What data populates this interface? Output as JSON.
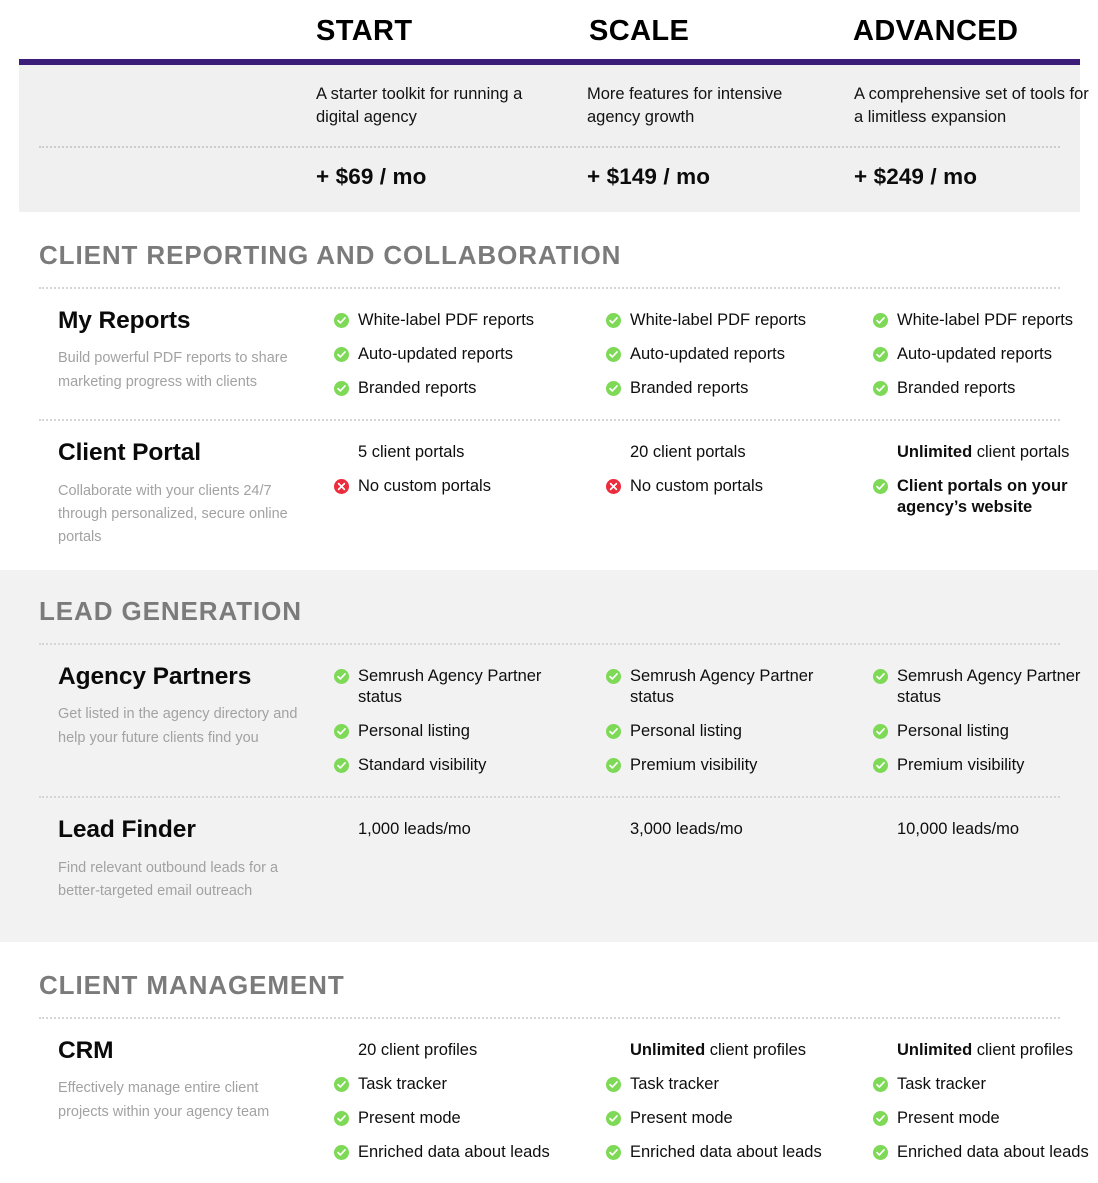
{
  "plans": [
    {
      "name": "START",
      "description": "A starter toolkit for running a digital agency",
      "price": "+ $69 / mo"
    },
    {
      "name": "SCALE",
      "description": "More features for intensive agency growth",
      "price": "+ $149 / mo"
    },
    {
      "name": "ADVANCED",
      "description": "A comprehensive set of tools for a limitless expansion",
      "price": "+ $249 / mo"
    }
  ],
  "colors": {
    "accent_purple": "#3b1d79",
    "check_green": "#7ed957",
    "cross_red": "#ec2b3c",
    "panel_gray": "#f0f0f0",
    "band_gray": "#f2f2f2",
    "section_title_gray": "#7b7b7b",
    "subtext_gray": "#a2a2a2"
  },
  "icons": {
    "check": "check-circle-icon",
    "cross": "cross-circle-icon"
  },
  "sections": [
    {
      "title": "CLIENT REPORTING AND COLLABORATION",
      "shaded": false,
      "features": [
        {
          "name": "My Reports",
          "subtitle": "Build powerful PDF reports to share marketing progress with clients",
          "cells": [
            {
              "items": [
                {
                  "icon": "check",
                  "text": "White-label PDF reports"
                },
                {
                  "icon": "check",
                  "text": "Auto-updated reports"
                },
                {
                  "icon": "check",
                  "text": "Branded reports"
                }
              ]
            },
            {
              "items": [
                {
                  "icon": "check",
                  "text": "White-label PDF reports"
                },
                {
                  "icon": "check",
                  "text": "Auto-updated reports"
                },
                {
                  "icon": "check",
                  "text": "Branded reports"
                }
              ]
            },
            {
              "items": [
                {
                  "icon": "check",
                  "text": "White-label PDF reports"
                },
                {
                  "icon": "check",
                  "text": "Auto-updated reports"
                },
                {
                  "icon": "check",
                  "text": "Branded reports"
                }
              ]
            }
          ]
        },
        {
          "name": "Client Portal",
          "subtitle": "Collaborate with your clients 24/7 through personalized, secure online portals",
          "cells": [
            {
              "items": [
                {
                  "icon": "none",
                  "text": "5 client portals"
                },
                {
                  "icon": "cross",
                  "text": "No custom portals"
                }
              ]
            },
            {
              "items": [
                {
                  "icon": "none",
                  "text": "20 client portals"
                },
                {
                  "icon": "cross",
                  "text": "No custom portals"
                }
              ]
            },
            {
              "items": [
                {
                  "icon": "none",
                  "text": "Unlimited client portals",
                  "bold_prefix": "Unlimited",
                  "rest": " client portals"
                },
                {
                  "icon": "check",
                  "text": "Client portals on your agency’s website",
                  "bold": true
                }
              ]
            }
          ]
        }
      ]
    },
    {
      "title": "LEAD GENERATION",
      "shaded": true,
      "features": [
        {
          "name": "Agency Partners",
          "subtitle": "Get listed in the agency directory and help your future clients find you",
          "cells": [
            {
              "items": [
                {
                  "icon": "check",
                  "text": "Semrush Agency Partner status"
                },
                {
                  "icon": "check",
                  "text": "Personal listing"
                },
                {
                  "icon": "check",
                  "text": "Standard visibility"
                }
              ]
            },
            {
              "items": [
                {
                  "icon": "check",
                  "text": "Semrush Agency Partner status"
                },
                {
                  "icon": "check",
                  "text": "Personal listing"
                },
                {
                  "icon": "check",
                  "text": "Premium visibility"
                }
              ]
            },
            {
              "items": [
                {
                  "icon": "check",
                  "text": "Semrush Agency Partner status"
                },
                {
                  "icon": "check",
                  "text": "Personal listing"
                },
                {
                  "icon": "check",
                  "text": "Premium visibility"
                }
              ]
            }
          ]
        },
        {
          "name": "Lead Finder",
          "subtitle": "Find relevant outbound leads for a better-targeted email outreach",
          "cells": [
            {
              "items": [
                {
                  "icon": "none",
                  "text": "1,000 leads/mo"
                }
              ]
            },
            {
              "items": [
                {
                  "icon": "none",
                  "text": "3,000 leads/mo"
                }
              ]
            },
            {
              "items": [
                {
                  "icon": "none",
                  "text": "10,000 leads/mo"
                }
              ]
            }
          ]
        }
      ]
    },
    {
      "title": "CLIENT MANAGEMENT",
      "shaded": false,
      "features": [
        {
          "name": "CRM",
          "subtitle": "Effectively manage entire client projects within your agency team",
          "cells": [
            {
              "items": [
                {
                  "icon": "none",
                  "text": "20 client profiles"
                },
                {
                  "icon": "check",
                  "text": "Task tracker"
                },
                {
                  "icon": "check",
                  "text": "Present mode"
                },
                {
                  "icon": "check",
                  "text": "Enriched data about leads"
                }
              ]
            },
            {
              "items": [
                {
                  "icon": "none",
                  "text": "Unlimited client profiles",
                  "bold_prefix": "Unlimited",
                  "rest": " client profiles"
                },
                {
                  "icon": "check",
                  "text": "Task tracker"
                },
                {
                  "icon": "check",
                  "text": "Present mode"
                },
                {
                  "icon": "check",
                  "text": "Enriched data about leads"
                }
              ]
            },
            {
              "items": [
                {
                  "icon": "none",
                  "text": "Unlimited client profiles",
                  "bold_prefix": "Unlimited",
                  "rest": " client profiles"
                },
                {
                  "icon": "check",
                  "text": "Task tracker"
                },
                {
                  "icon": "check",
                  "text": "Present mode"
                },
                {
                  "icon": "check",
                  "text": "Enriched data about leads"
                }
              ]
            }
          ]
        }
      ]
    }
  ]
}
